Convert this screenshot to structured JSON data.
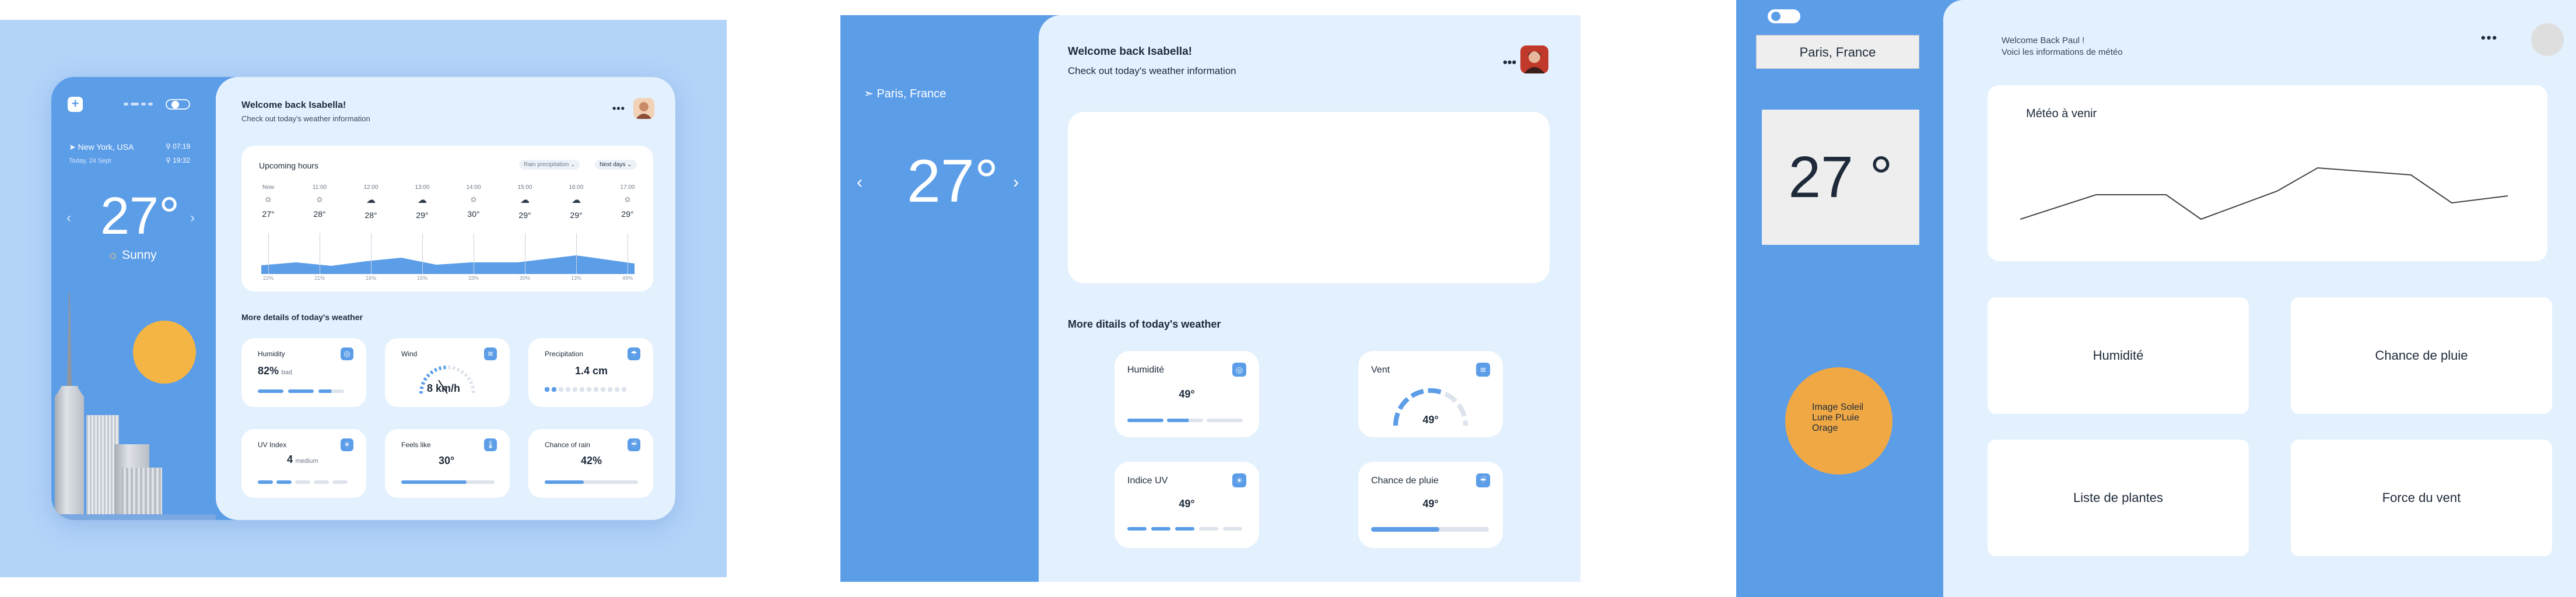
{
  "panel1": {
    "city": "New York, USA",
    "date": "Today, 24 Sept",
    "time1": "07:19",
    "time2": "19:32",
    "temp": "27°",
    "condition": "Sunny",
    "welcome": "Welcome back Isabella!",
    "subtitle": "Check out today's weather information",
    "upcoming_title": "Upcoming hours",
    "pill1": "Rain precipitation",
    "pill2": "Next days",
    "hours": [
      {
        "h": "Now",
        "icon": "☼",
        "t": "27°",
        "p": "22%"
      },
      {
        "h": "11:00",
        "icon": "☼",
        "t": "28°",
        "p": "21%"
      },
      {
        "h": "12:00",
        "icon": "☁",
        "t": "28°",
        "p": "16%"
      },
      {
        "h": "13:00",
        "icon": "☁",
        "t": "29°",
        "p": "15%"
      },
      {
        "h": "14:00",
        "icon": "☼",
        "t": "30°",
        "p": "33%"
      },
      {
        "h": "15:00",
        "icon": "☁",
        "t": "29°",
        "p": "30%"
      },
      {
        "h": "16:00",
        "icon": "☁",
        "t": "29°",
        "p": "13%"
      },
      {
        "h": "17:00",
        "icon": "☼",
        "t": "29°",
        "p": "49%"
      }
    ],
    "more_title": "More details of today's weather",
    "cards": {
      "humidity": {
        "label": "Humidity",
        "value": "82%",
        "unit": "bad"
      },
      "wind": {
        "label": "Wind",
        "value": "8 km/h"
      },
      "precip": {
        "label": "Precipitation",
        "value": "1.4 cm"
      },
      "uv": {
        "label": "UV Index",
        "value": "4",
        "unit": "medium"
      },
      "feels": {
        "label": "Feels like",
        "value": "30°"
      },
      "rain": {
        "label": "Chance of rain",
        "value": "42%"
      }
    }
  },
  "panel2": {
    "location": "Paris, France",
    "temp": "27°",
    "welcome": "Welcome back Isabella!",
    "subtitle": "Check out today's weather information",
    "dots": "•••",
    "more_title": "More ditails of today's weather",
    "cards": [
      {
        "label": "Humidité",
        "value": "49°"
      },
      {
        "label": "Vent",
        "value": "49°"
      },
      {
        "label": "Indice UV",
        "value": "49°"
      },
      {
        "label": "Chance de pluie",
        "value": "49°"
      }
    ]
  },
  "panel3": {
    "city": "Paris, France",
    "temp": "27 °",
    "circle_lines": [
      "Image Soleil",
      "Lune PLuie",
      "Orage"
    ],
    "welcome1": "Welcome Back Paul !",
    "welcome2": "Voici les informations de météo",
    "dots": "•••",
    "chart_title": "Météo à venir",
    "tiles": [
      "Humidité",
      "Chance de pluie",
      "Liste de plantes",
      "Force du vent"
    ]
  },
  "colors": {
    "primary": "#5c9de8",
    "bg_light": "#e3f0fd",
    "sun": "#f5b544",
    "frame": "#b3d3f9"
  }
}
